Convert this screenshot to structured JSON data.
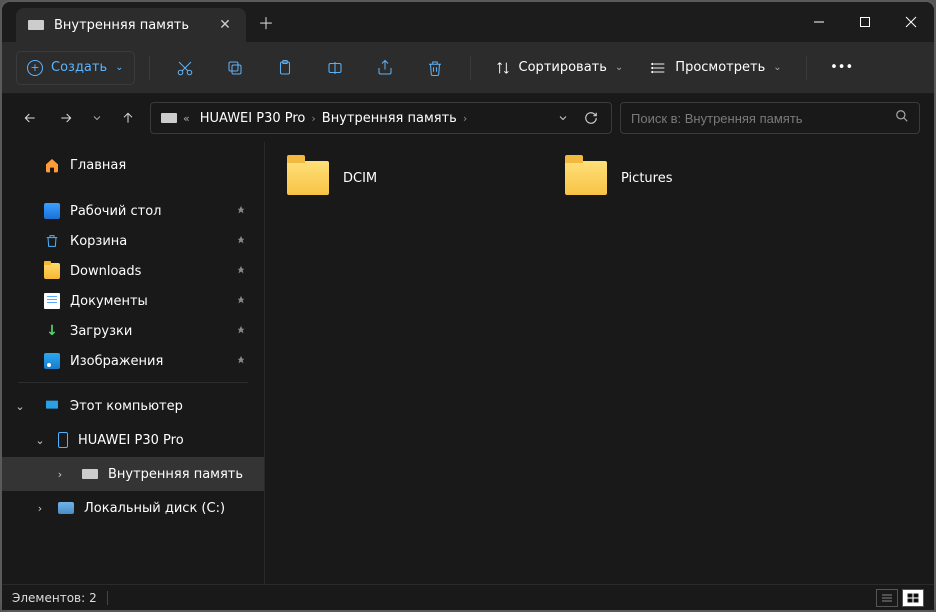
{
  "tab": {
    "title": "Внутренняя память"
  },
  "toolbar": {
    "new_label": "Создать",
    "sort_label": "Сортировать",
    "view_label": "Просмотреть"
  },
  "breadcrumbs": {
    "device": "HUAWEI P30 Pro",
    "storage": "Внутренняя память"
  },
  "search": {
    "placeholder": "Поиск в: Внутренняя память"
  },
  "sidebar": {
    "home": "Главная",
    "quick": [
      {
        "label": "Рабочий стол"
      },
      {
        "label": "Корзина"
      },
      {
        "label": "Downloads"
      },
      {
        "label": "Документы"
      },
      {
        "label": "Загрузки"
      },
      {
        "label": "Изображения"
      }
    ],
    "this_pc": "Этот компьютер",
    "device": "HUAWEI P30 Pro",
    "internal": "Внутренняя память",
    "local_disk": "Локальный диск (C:)"
  },
  "content": {
    "items": [
      {
        "name": "DCIM"
      },
      {
        "name": "Pictures"
      }
    ]
  },
  "status": {
    "count_label": "Элементов:",
    "count_value": "2"
  }
}
